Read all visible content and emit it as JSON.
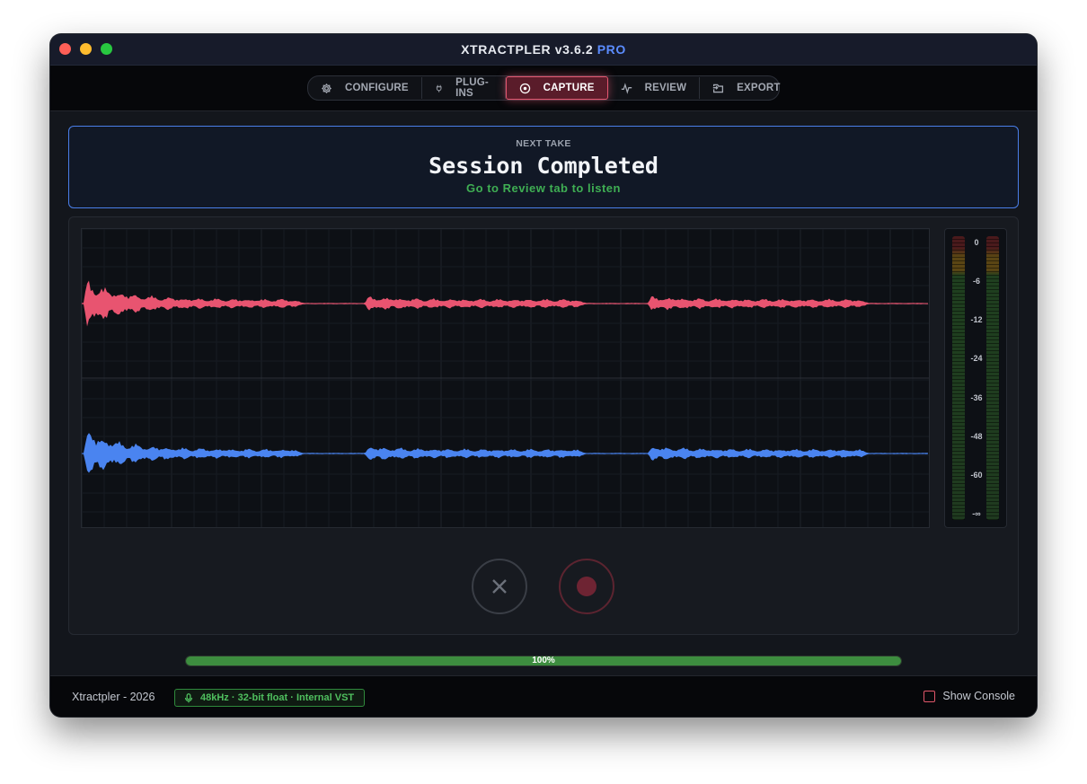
{
  "window": {
    "title_main": "XTRACTPLER v3.6.2",
    "title_badge": "PRO"
  },
  "tabs": [
    {
      "label": "CONFIGURE",
      "icon": "gear-icon"
    },
    {
      "label": "PLUG-INS",
      "icon": "plug-icon"
    },
    {
      "label": "CAPTURE",
      "icon": "record-circle-icon",
      "active": true
    },
    {
      "label": "REVIEW",
      "icon": "pulse-icon"
    },
    {
      "label": "EXPORT",
      "icon": "export-icon"
    }
  ],
  "banner": {
    "label": "NEXT TAKE",
    "headline": "Session Completed",
    "subtext": "Go to Review tab to listen"
  },
  "meter": {
    "ticks": [
      "0",
      "-6",
      "-12",
      "-24",
      "-36",
      "-48",
      "-60",
      "-∞"
    ]
  },
  "progress": {
    "value": 100,
    "label": "100%"
  },
  "footer": {
    "brand": "Xtractpler - 2026",
    "audio_badge": "48kHz · 32-bit float · Internal VST",
    "console_label": "Show Console",
    "console_checked": false
  },
  "colors": {
    "accent_capture": "#e2566f",
    "channel_left": "#e85470",
    "channel_right": "#4a84f0",
    "success": "#3fae53",
    "banner_border": "#4a7ee8"
  }
}
